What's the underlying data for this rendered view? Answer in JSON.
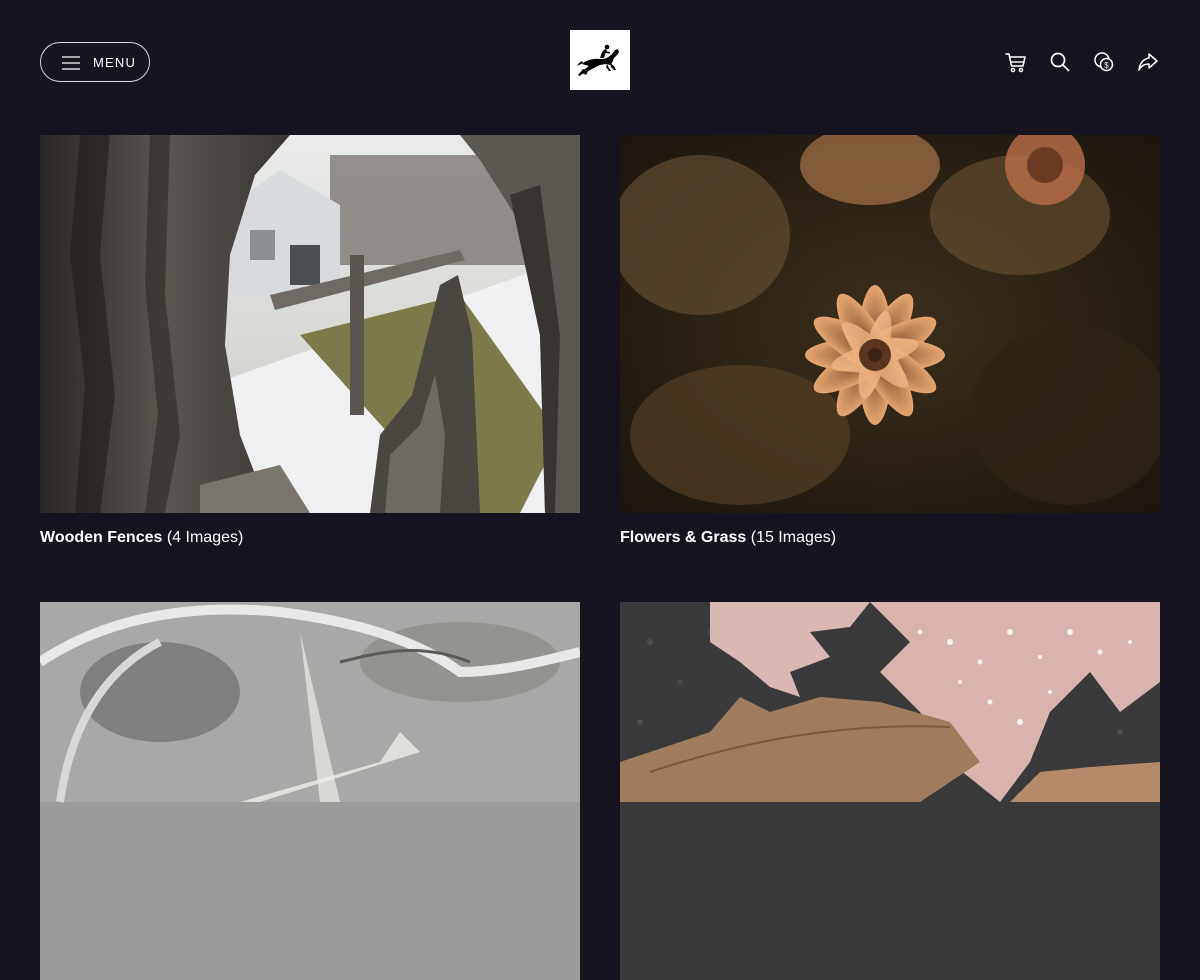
{
  "header": {
    "menu_label": "MENU",
    "logo": "horse-jumper-logo",
    "actions": [
      {
        "name": "cart-icon"
      },
      {
        "name": "search-icon"
      },
      {
        "name": "currency-icon"
      },
      {
        "name": "share-icon"
      }
    ]
  },
  "gallery": {
    "items": [
      {
        "title": "Wooden Fences",
        "count": "(4 Images)",
        "image": "weathered fence post with snowy barn background"
      },
      {
        "title": "Flowers & Grass",
        "count": "(15 Images)",
        "image": "dried orange flower in brush"
      },
      {
        "title": "",
        "count": "",
        "image": "cracked ice texture"
      },
      {
        "title": "",
        "count": "",
        "image": "oak leaves with water droplets"
      }
    ]
  },
  "colors": {
    "background": "#16151f",
    "text": "#ffffff",
    "border": "#d8d8dc"
  }
}
